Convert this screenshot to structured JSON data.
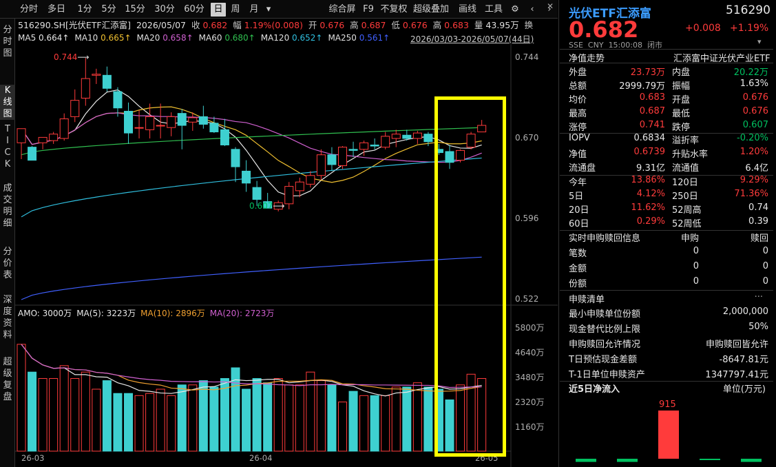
{
  "toolbar": {
    "items": [
      "分时",
      "多日",
      "1分",
      "5分",
      "15分",
      "30分",
      "60分",
      "日",
      "周",
      "月",
      "▾",
      "综合屏",
      "F9",
      "不复权",
      "超级叠加",
      "画线",
      "工具"
    ],
    "active": "日"
  },
  "leftbar": {
    "items": [
      "分时图",
      "K线图",
      "TICK",
      "成交明细",
      "分价表",
      "深度资料",
      "超级复盘"
    ],
    "active": "K线图"
  },
  "info": {
    "code": "516290.SH[光伏ETF汇添富]",
    "date": "2026/05/07",
    "close_label": "收",
    "close": "0.682",
    "amp_label": "幅",
    "amp": "1.19%(0.008)",
    "open_label": "开",
    "open": "0.676",
    "high_label": "高",
    "high": "0.687",
    "low_label": "低",
    "low": "0.676",
    "highp_label": "高",
    "highp": "0.683",
    "vol_label": "量",
    "vol": "43.95万",
    "swap_label": "换"
  },
  "ma": [
    {
      "label": "MA5",
      "value": "0.664↑",
      "color": "#e8e8e8"
    },
    {
      "label": "MA10",
      "value": "0.665↑",
      "color": "#f0c030"
    },
    {
      "label": "MA20",
      "value": "0.658↑",
      "color": "#d060d0"
    },
    {
      "label": "MA60",
      "value": "0.680↑",
      "color": "#30c050"
    },
    {
      "label": "MA120",
      "value": "0.652↑",
      "color": "#30c0e0"
    },
    {
      "label": "MA250",
      "value": "0.561↑",
      "color": "#4060ff"
    }
  ],
  "range": "2026/03/03-2026/05/07(44日)",
  "amo": [
    {
      "label": "AMO: 3000万",
      "color": "#e8e8e8"
    },
    {
      "label": "MA(5): 3223万",
      "color": "#e8e8e8"
    },
    {
      "label": "MA(10): 2896万",
      "color": "#f0a030"
    },
    {
      "label": "MA(20): 2723万",
      "color": "#d060d0"
    }
  ],
  "annotations": {
    "high": "0.744",
    "low": "0.607"
  },
  "colors": {
    "up": "#ff3b3b",
    "down": "#3ed0d0",
    "highlight": "#ffff00"
  },
  "chart_data": {
    "type": "candlestick",
    "price_axis": {
      "ticks": [
        "0.744",
        "0.670",
        "0.596",
        "0.522"
      ],
      "min": 0.522,
      "max": 0.744
    },
    "volume_axis": {
      "ticks": [
        "5800万",
        "4640万",
        "3480万",
        "2320万",
        "1160万"
      ],
      "unit": "万"
    },
    "x_labels": [
      "26-03",
      "26-04",
      "26-05"
    ],
    "candles": [
      {
        "o": 0.666,
        "h": 0.67,
        "l": 0.651,
        "c": 0.679
      },
      {
        "o": 0.662,
        "h": 0.663,
        "l": 0.65,
        "c": 0.65
      },
      {
        "o": 0.666,
        "h": 0.67,
        "l": 0.66,
        "c": 0.671
      },
      {
        "o": 0.668,
        "h": 0.676,
        "l": 0.665,
        "c": 0.674
      },
      {
        "o": 0.67,
        "h": 0.693,
        "l": 0.668,
        "c": 0.688
      },
      {
        "o": 0.69,
        "h": 0.715,
        "l": 0.685,
        "c": 0.705
      },
      {
        "o": 0.707,
        "h": 0.744,
        "l": 0.7,
        "c": 0.725
      },
      {
        "o": 0.728,
        "h": 0.734,
        "l": 0.72,
        "c": 0.729
      },
      {
        "o": 0.728,
        "h": 0.736,
        "l": 0.713,
        "c": 0.716
      },
      {
        "o": 0.713,
        "h": 0.717,
        "l": 0.69,
        "c": 0.698
      },
      {
        "o": 0.695,
        "h": 0.703,
        "l": 0.665,
        "c": 0.675
      },
      {
        "o": 0.68,
        "h": 0.696,
        "l": 0.67,
        "c": 0.68
      },
      {
        "o": 0.678,
        "h": 0.702,
        "l": 0.67,
        "c": 0.69
      },
      {
        "o": 0.682,
        "h": 0.702,
        "l": 0.67,
        "c": 0.682
      },
      {
        "o": 0.68,
        "h": 0.694,
        "l": 0.672,
        "c": 0.69
      },
      {
        "o": 0.693,
        "h": 0.697,
        "l": 0.66,
        "c": 0.682
      },
      {
        "o": 0.685,
        "h": 0.694,
        "l": 0.677,
        "c": 0.689
      },
      {
        "o": 0.69,
        "h": 0.7,
        "l": 0.679,
        "c": 0.683
      },
      {
        "o": 0.684,
        "h": 0.69,
        "l": 0.675,
        "c": 0.676
      },
      {
        "o": 0.678,
        "h": 0.688,
        "l": 0.663,
        "c": 0.664
      },
      {
        "o": 0.66,
        "h": 0.662,
        "l": 0.63,
        "c": 0.644
      },
      {
        "o": 0.64,
        "h": 0.65,
        "l": 0.621,
        "c": 0.629
      },
      {
        "o": 0.625,
        "h": 0.631,
        "l": 0.608,
        "c": 0.614
      },
      {
        "o": 0.612,
        "h": 0.62,
        "l": 0.607,
        "c": 0.606
      },
      {
        "o": 0.605,
        "h": 0.613,
        "l": 0.603,
        "c": 0.611
      },
      {
        "o": 0.61,
        "h": 0.63,
        "l": 0.605,
        "c": 0.626
      },
      {
        "o": 0.622,
        "h": 0.634,
        "l": 0.616,
        "c": 0.63
      },
      {
        "o": 0.628,
        "h": 0.64,
        "l": 0.625,
        "c": 0.636
      },
      {
        "o": 0.636,
        "h": 0.66,
        "l": 0.632,
        "c": 0.655
      },
      {
        "o": 0.655,
        "h": 0.662,
        "l": 0.64,
        "c": 0.646
      },
      {
        "o": 0.645,
        "h": 0.663,
        "l": 0.642,
        "c": 0.662
      },
      {
        "o": 0.66,
        "h": 0.667,
        "l": 0.653,
        "c": 0.659
      },
      {
        "o": 0.66,
        "h": 0.668,
        "l": 0.654,
        "c": 0.666
      },
      {
        "o": 0.664,
        "h": 0.67,
        "l": 0.66,
        "c": 0.663
      },
      {
        "o": 0.662,
        "h": 0.676,
        "l": 0.66,
        "c": 0.672
      },
      {
        "o": 0.67,
        "h": 0.678,
        "l": 0.662,
        "c": 0.674
      },
      {
        "o": 0.673,
        "h": 0.678,
        "l": 0.668,
        "c": 0.67
      },
      {
        "o": 0.67,
        "h": 0.677,
        "l": 0.665,
        "c": 0.675
      },
      {
        "o": 0.674,
        "h": 0.676,
        "l": 0.663,
        "c": 0.667
      },
      {
        "o": 0.66,
        "h": 0.665,
        "l": 0.655,
        "c": 0.657
      },
      {
        "o": 0.658,
        "h": 0.664,
        "l": 0.642,
        "c": 0.648
      },
      {
        "o": 0.65,
        "h": 0.66,
        "l": 0.648,
        "c": 0.659
      },
      {
        "o": 0.662,
        "h": 0.676,
        "l": 0.66,
        "c": 0.674
      },
      {
        "o": 0.676,
        "h": 0.687,
        "l": 0.676,
        "c": 0.682
      }
    ],
    "volumes": [
      5000,
      3700,
      3400,
      3400,
      4000,
      3400,
      3700,
      2900,
      3300,
      2700,
      2700,
      2600,
      2700,
      2900,
      2600,
      3100,
      3100,
      3300,
      3000,
      3400,
      3900,
      2900,
      3400,
      3200,
      3400,
      3100,
      3100,
      3700,
      3300,
      3100,
      2300,
      2800,
      2600,
      2600,
      2600,
      3000,
      3000,
      3200,
      3000,
      2900,
      2400,
      3100,
      3600,
      3400
    ],
    "volume_up": [
      true,
      false,
      true,
      true,
      true,
      true,
      true,
      true,
      false,
      false,
      false,
      true,
      true,
      true,
      true,
      false,
      true,
      false,
      false,
      false,
      false,
      false,
      false,
      false,
      true,
      true,
      true,
      true,
      true,
      false,
      true,
      false,
      true,
      false,
      true,
      true,
      false,
      true,
      false,
      false,
      false,
      true,
      true,
      true
    ]
  },
  "right": {
    "title": "光伏ETF汇添富",
    "code": "516290",
    "price": "0.682",
    "change": "+0.008",
    "pct": "+1.19%",
    "sub": [
      "SSE",
      "CNY",
      "15:00:08",
      "闭市"
    ],
    "nav_trend": "净值走势",
    "index_name": "汇添富中证光伏产业ETF",
    "rows1": [
      {
        "l1": "外盘",
        "v1": "23.73万",
        "c1": "red",
        "l2": "内盘",
        "v2": "20.22万",
        "c2": "grn"
      },
      {
        "l1": "总额",
        "v1": "2999.79万",
        "c1": "wht",
        "l2": "振幅",
        "v2": "1.63%",
        "c2": "wht"
      },
      {
        "l1": "均价",
        "v1": "0.683",
        "c1": "red",
        "l2": "开盘",
        "v2": "0.676",
        "c2": "red"
      },
      {
        "l1": "最高",
        "v1": "0.687",
        "c1": "red",
        "l2": "最低",
        "v2": "0.676",
        "c2": "red"
      },
      {
        "l1": "涨停",
        "v1": "0.741",
        "c1": "red",
        "l2": "跌停",
        "v2": "0.607",
        "c2": "grn"
      }
    ],
    "rows2": [
      {
        "l1": "IOPV",
        "v1": "0.6834",
        "c1": "wht",
        "l2": "溢折率",
        "v2": "-0.20%",
        "c2": "grn"
      },
      {
        "l1": "净值",
        "v1": "0.6739",
        "c1": "red",
        "l2": "升贴水率",
        "v2": "1.20%",
        "c2": "red"
      },
      {
        "l1": "流通盘",
        "v1": "9.31亿",
        "c1": "wht",
        "l2": "流通值",
        "v2": "6.4亿",
        "c2": "wht"
      }
    ],
    "rows3": [
      {
        "l1": "今年",
        "v1": "13.86%",
        "c1": "red",
        "l2": "120日",
        "v2": "9.29%",
        "c2": "red"
      },
      {
        "l1": "5日",
        "v1": "4.12%",
        "c1": "red",
        "l2": "250日",
        "v2": "71.36%",
        "c2": "red"
      },
      {
        "l1": "20日",
        "v1": "11.62%",
        "c1": "red",
        "l2": "52周高",
        "v2": "0.74",
        "c2": "wht"
      },
      {
        "l1": "60日",
        "v1": "0.29%",
        "c1": "red",
        "l2": "52周低",
        "v2": "0.39",
        "c2": "wht"
      }
    ],
    "sg_title": "实时申购赎回信息",
    "sg_buy": "申购",
    "sg_sell": "赎回",
    "sg_rows": [
      {
        "l": "笔数",
        "a": "0",
        "b": "0"
      },
      {
        "l": "金额",
        "a": "0",
        "b": "0"
      },
      {
        "l": "份额",
        "a": "0",
        "b": "0"
      }
    ],
    "list_title": "申赎清单",
    "list_more": "···",
    "list_rows": [
      {
        "l": "最小申赎单位份额",
        "v": "2,000,000"
      },
      {
        "l": "现金替代比例上限",
        "v": "50%"
      },
      {
        "l": "申购赎回允许情况",
        "v": "申购赎回皆允许"
      },
      {
        "l": "T日预估现金差额",
        "v": "-8647.81元"
      },
      {
        "l": "T-1日单位申赎资产",
        "v": "1347797.41元"
      }
    ],
    "flow_title": "近5日净流入",
    "flow_unit": "单位(万元)",
    "flow_value_label": "915",
    "flow_values": [
      -60,
      -60,
      915,
      -10,
      -60
    ]
  }
}
